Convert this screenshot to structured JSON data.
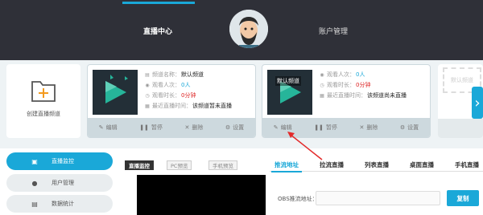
{
  "nav": {
    "tab_live_center": "直播中心",
    "tab_account": "账户管理",
    "accent": "#1aa8d8"
  },
  "create_channel": {
    "label": "创建直播频道"
  },
  "cards": [
    {
      "thumb_label": "",
      "fields": [
        {
          "key": "频道名称：",
          "value": "默认频道",
          "style": "normal"
        },
        {
          "key": "观看人次：",
          "value": "0人",
          "style": "blue"
        },
        {
          "key": "观看时长：",
          "value": "0分钟",
          "style": "red"
        },
        {
          "key": "最近直播时间：",
          "value": "该频道暂未直播",
          "style": "normal"
        }
      ],
      "actions": {
        "edit": "编辑",
        "pause": "暂停",
        "delete": "删除",
        "settings": "设置"
      }
    },
    {
      "thumb_label": "默认频道",
      "fields": [
        {
          "key": "观看人次：",
          "value": "0人",
          "style": "blue"
        },
        {
          "key": "观看时长：",
          "value": "0分钟",
          "style": "red"
        },
        {
          "key": "最近直播时间：",
          "value": "该频道尚未直播",
          "style": "normal"
        }
      ],
      "actions": {
        "edit": "编辑",
        "pause": "暂停",
        "delete": "删除",
        "settings": "设置"
      }
    }
  ],
  "ghost_card": {
    "label": "默认频道"
  },
  "sidebar": {
    "items": [
      {
        "label": "直播监控",
        "icon": "monitor-icon"
      },
      {
        "label": "用户管理",
        "icon": "user-icon"
      },
      {
        "label": "数据统计",
        "icon": "stats-icon"
      }
    ]
  },
  "monitor_tabs": [
    "直播监控",
    "PC预览",
    "手机预览"
  ],
  "right_tabs": [
    "推流地址",
    "拉流直播",
    "列表直播",
    "桌面直播",
    "手机直播"
  ],
  "obs": {
    "label": "OBS推流地址：",
    "value": "",
    "copy": "复制"
  }
}
